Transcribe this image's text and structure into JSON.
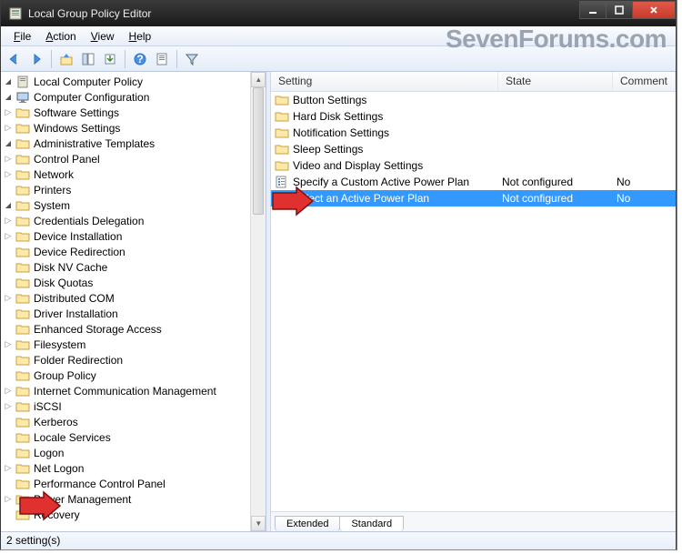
{
  "window": {
    "title": "Local Group Policy Editor"
  },
  "menu": {
    "file": "File",
    "action": "Action",
    "view": "View",
    "help": "Help"
  },
  "watermark": "SevenForums.com",
  "tree": {
    "root": "Local Computer Policy",
    "cc": "Computer Configuration",
    "sw": "Software Settings",
    "ws": "Windows Settings",
    "at": {
      "label": "Administrative Templates",
      "cp": "Control Panel",
      "net": "Network",
      "prn": "Printers",
      "sys": {
        "label": "System",
        "items": [
          "Credentials Delegation",
          "Device Installation",
          "Device Redirection",
          "Disk NV Cache",
          "Disk Quotas",
          "Distributed COM",
          "Driver Installation",
          "Enhanced Storage Access",
          "Filesystem",
          "Folder Redirection",
          "Group Policy",
          "Internet Communication Management",
          "iSCSI",
          "Kerberos",
          "Locale Services",
          "Logon",
          "Net Logon",
          "Performance Control Panel",
          "Power Management",
          "Recovery"
        ]
      }
    }
  },
  "system_expandable": [
    true,
    true,
    false,
    false,
    false,
    true,
    false,
    false,
    true,
    false,
    false,
    true,
    true,
    false,
    false,
    false,
    true,
    false,
    true,
    false
  ],
  "list": {
    "cols": {
      "setting": "Setting",
      "state": "State",
      "comment": "Comment"
    },
    "rows": [
      {
        "type": "folder",
        "setting": "Button Settings",
        "state": "",
        "comment": ""
      },
      {
        "type": "folder",
        "setting": "Hard Disk Settings",
        "state": "",
        "comment": ""
      },
      {
        "type": "folder",
        "setting": "Notification Settings",
        "state": "",
        "comment": ""
      },
      {
        "type": "folder",
        "setting": "Sleep Settings",
        "state": "",
        "comment": ""
      },
      {
        "type": "folder",
        "setting": "Video and Display Settings",
        "state": "",
        "comment": ""
      },
      {
        "type": "policy",
        "setting": "Specify a Custom Active Power Plan",
        "state": "Not configured",
        "comment": "No"
      },
      {
        "type": "policy",
        "setting": "Select an Active Power Plan",
        "state": "Not configured",
        "comment": "No"
      }
    ],
    "selected": 6
  },
  "tabs": {
    "extended": "Extended",
    "standard": "Standard"
  },
  "status": "2 setting(s)"
}
